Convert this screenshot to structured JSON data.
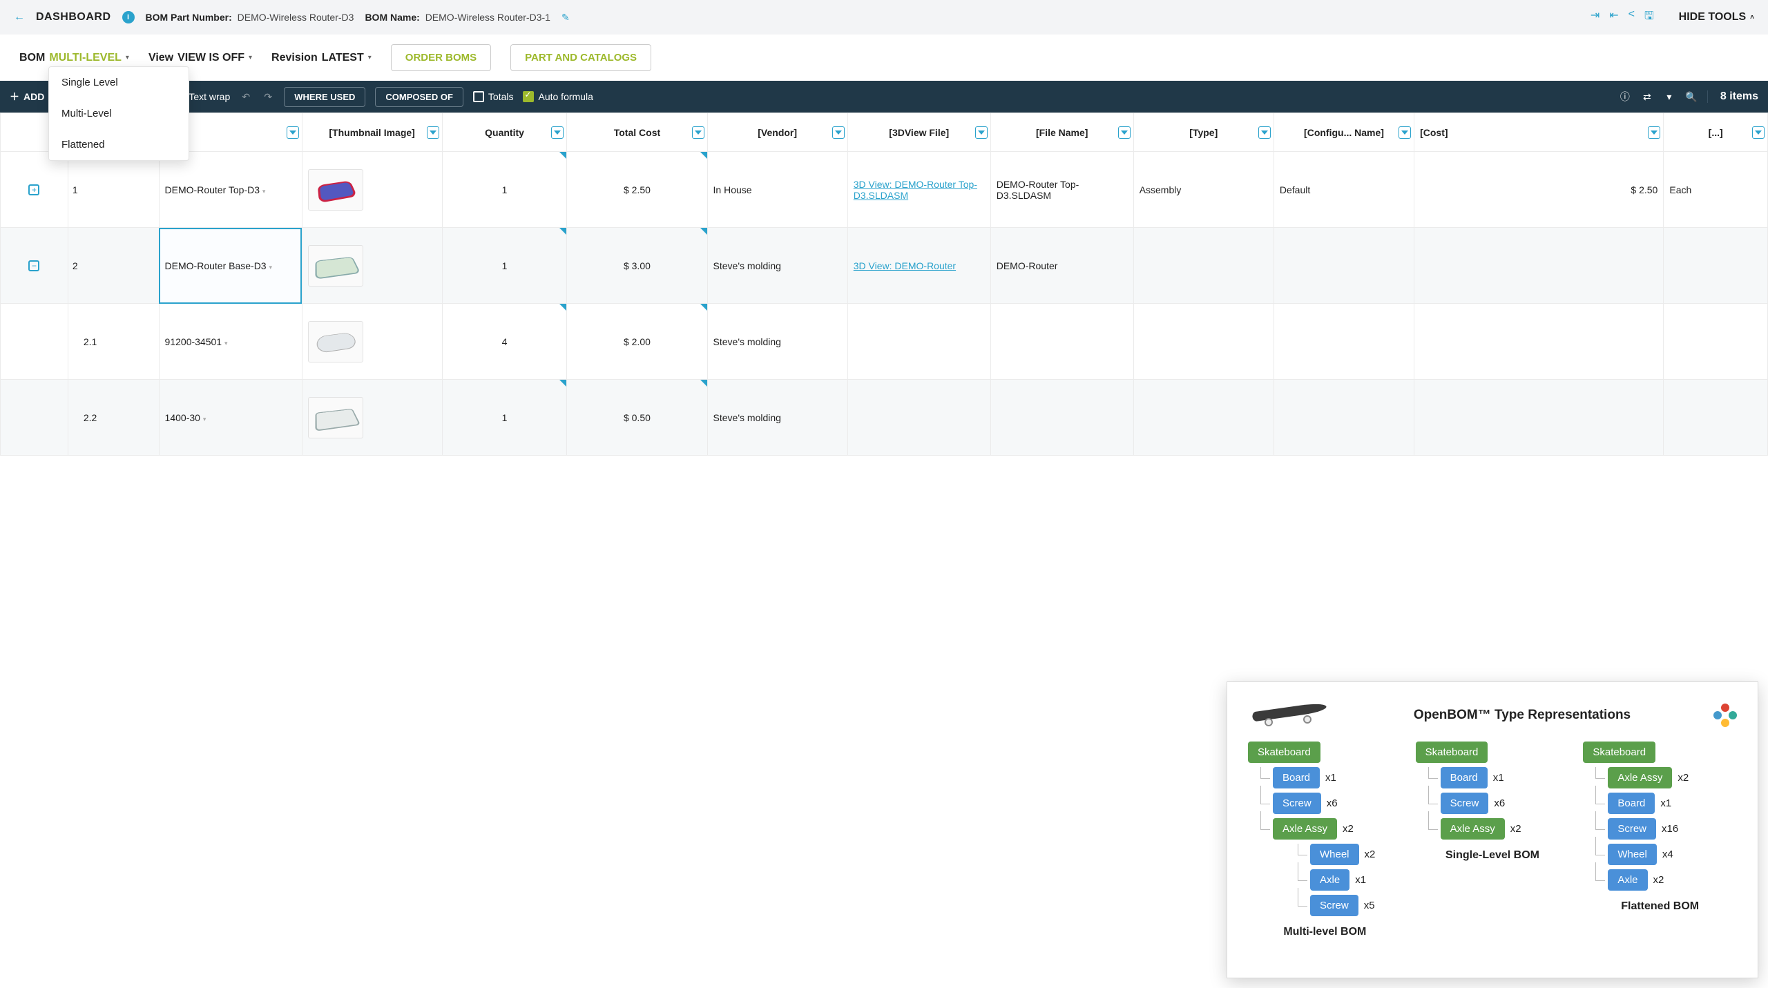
{
  "header": {
    "dashboard": "DASHBOARD",
    "partnum_label": "BOM Part Number:",
    "partnum_value": "DEMO-Wireless Router-D3",
    "bomname_label": "BOM Name:",
    "bomname_value": "DEMO-Wireless Router-D3-1",
    "hide_tools": "HIDE TOOLS"
  },
  "toolbar2": {
    "bom_label": "BOM",
    "bom_value": "MULTI-LEVEL",
    "view_label": "View",
    "view_value": "VIEW IS OFF",
    "rev_label": "Revision",
    "rev_value": "LATEST",
    "btn_order": "ORDER BOMS",
    "btn_part": "PART AND CATALOGS"
  },
  "dropdown": {
    "items": [
      "Single Level",
      "Multi-Level",
      "Flattened"
    ]
  },
  "darkbar": {
    "add": "ADD",
    "text_wrap": "Text wrap",
    "where_used": "WHERE USED",
    "composed_of": "COMPOSED OF",
    "totals": "Totals",
    "auto_formula": "Auto formula",
    "items": "8 items"
  },
  "columns": [
    "",
    "",
    "[Thumbnail Image]",
    "Quantity",
    "Total Cost",
    "[Vendor]",
    "[3DView File]",
    "[File Name]",
    "[Type]",
    "[Configu... Name]",
    "[Cost]",
    "[...]"
  ],
  "rows": [
    {
      "level": "1",
      "expand": "plus",
      "name": "DEMO-Router Top-D3",
      "thumb": "shape1",
      "qty": "1",
      "total": "$ 2.50",
      "vendor": "In House",
      "view3d": "3D View: DEMO-Router Top-D3.SLDASM",
      "filename": "DEMO-Router Top-D3.SLDASM",
      "type": "Assembly",
      "config": "Default",
      "cost": "$ 2.50",
      "unit": "Each"
    },
    {
      "level": "2",
      "expand": "minus",
      "name": "DEMO-Router Base-D3",
      "thumb": "shape2",
      "qty": "1",
      "total": "$ 3.00",
      "vendor": "Steve's molding",
      "view3d": "3D View: DEMO-Router",
      "filename": "DEMO-Router",
      "type": "",
      "config": "",
      "cost": "",
      "unit": "",
      "selected": true
    },
    {
      "level": "2.1",
      "expand": "",
      "name": "91200-34501",
      "thumb": "shape3",
      "qty": "4",
      "total": "$ 2.00",
      "vendor": "Steve's molding",
      "view3d": "",
      "filename": "",
      "type": "",
      "config": "",
      "cost": "",
      "unit": ""
    },
    {
      "level": "2.2",
      "expand": "",
      "name": "1400-30",
      "thumb": "shape4",
      "qty": "1",
      "total": "$ 0.50",
      "vendor": "Steve's molding",
      "view3d": "",
      "filename": "",
      "type": "",
      "config": "",
      "cost": "",
      "unit": ""
    }
  ],
  "overlay": {
    "title": "OpenBOM™ Type Representations",
    "cols": [
      {
        "title": "Multi-level BOM",
        "root": "Skateboard",
        "items": [
          {
            "label": "Board",
            "cls": "part",
            "qty": "x1"
          },
          {
            "label": "Screw",
            "cls": "part",
            "qty": "x6"
          },
          {
            "label": "Axle Assy",
            "cls": "assy",
            "qty": "x2",
            "children": [
              {
                "label": "Wheel",
                "cls": "part",
                "qty": "x2"
              },
              {
                "label": "Axle",
                "cls": "part",
                "qty": "x1"
              },
              {
                "label": "Screw",
                "cls": "part",
                "qty": "x5"
              }
            ]
          }
        ]
      },
      {
        "title": "Single-Level BOM",
        "root": "Skateboard",
        "items": [
          {
            "label": "Board",
            "cls": "part",
            "qty": "x1"
          },
          {
            "label": "Screw",
            "cls": "part",
            "qty": "x6"
          },
          {
            "label": "Axle Assy",
            "cls": "assy",
            "qty": "x2"
          }
        ]
      },
      {
        "title": "Flattened BOM",
        "root": "Skateboard",
        "items": [
          {
            "label": "Axle Assy",
            "cls": "assy",
            "qty": "x2"
          },
          {
            "label": "Board",
            "cls": "part",
            "qty": "x1"
          },
          {
            "label": "Screw",
            "cls": "part",
            "qty": "x16"
          },
          {
            "label": "Wheel",
            "cls": "part",
            "qty": "x4"
          },
          {
            "label": "Axle",
            "cls": "part",
            "qty": "x2"
          }
        ]
      }
    ]
  }
}
